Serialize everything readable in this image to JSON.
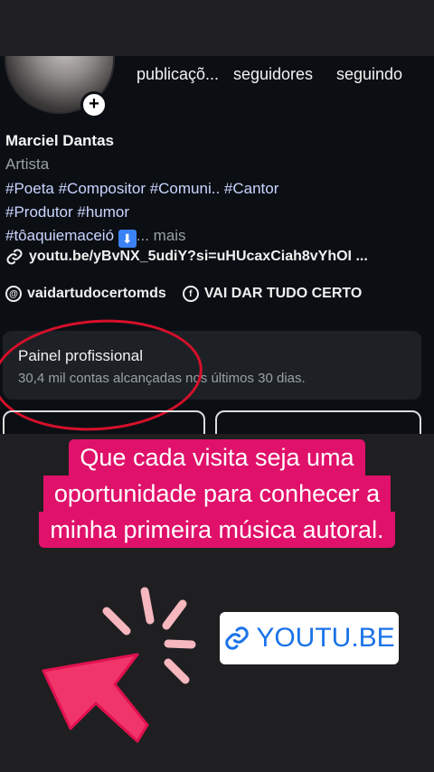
{
  "profile": {
    "stats": {
      "posts_label": "publicaçõ...",
      "followers_label": "seguidores",
      "following_label": "seguindo"
    },
    "name": "Marciel Dantas",
    "category": "Artista",
    "bio_line1": "#Poeta #Compositor #Comuni.. #Cantor",
    "bio_line2": "#Produtor #humor",
    "bio_line3_tag": "#tôaquiemaceió",
    "bio_more": "... mais",
    "link": "youtu.be/yBvNX_5udiY?si=uHUcaxCiah8vYhOI ...",
    "threads_handle": "vaidartudocertomds",
    "facebook_name": "VAI DAR TUDO CERTO",
    "panel": {
      "title": "Painel profissional",
      "subtitle": "30,4 mil contas alcançadas nos últimos 30 dias."
    }
  },
  "story": {
    "caption_line1": "Que cada visita seja uma",
    "caption_line2": "oportunidade para conhecer a",
    "caption_line3": "minha primeira música autoral.",
    "link_sticker": "YOUTU.BE"
  },
  "colors": {
    "caption_bg": "#e0116a",
    "annotation_red": "#d6102a",
    "arrow_pink": "#f0356b",
    "link_blue": "#1a73e8"
  }
}
